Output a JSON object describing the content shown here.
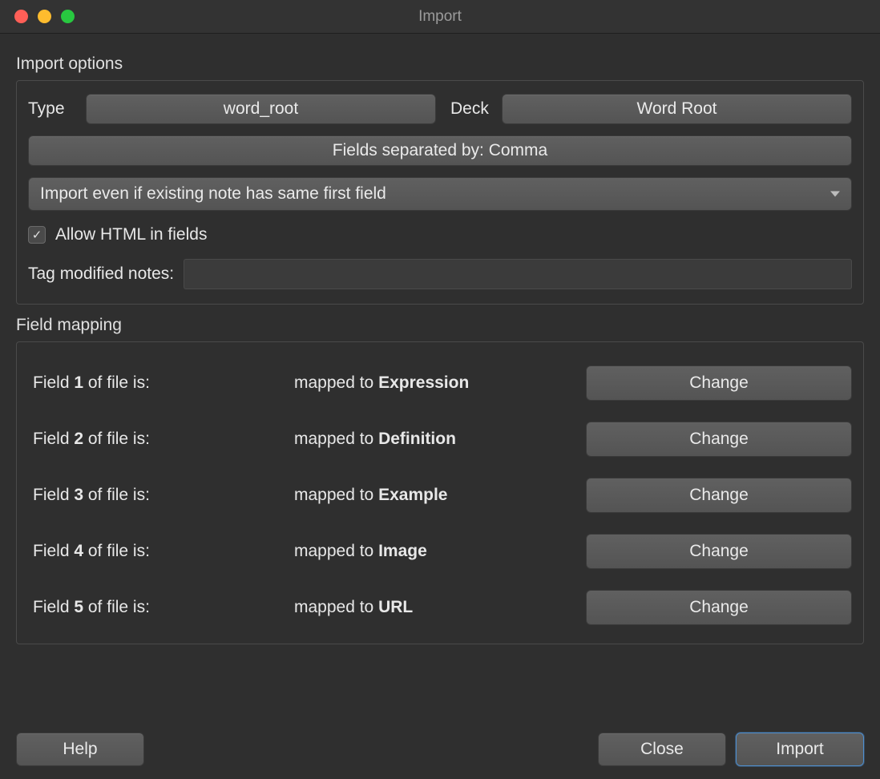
{
  "window": {
    "title": "Import"
  },
  "importOptions": {
    "section_label": "Import options",
    "type_label": "Type",
    "type_value": "word_root",
    "deck_label": "Deck",
    "deck_value": "Word Root",
    "separator_button": "Fields separated by: Comma",
    "update_mode": "Import even if existing note has same first field",
    "allow_html_label": "Allow HTML in fields",
    "allow_html_checked": true,
    "tag_modified_label": "Tag modified notes:",
    "tag_modified_value": ""
  },
  "fieldMapping": {
    "section_label": "Field mapping",
    "field_prefix": "Field ",
    "field_suffix": " of file is:",
    "mapped_prefix": "mapped to ",
    "change_label": "Change",
    "rows": [
      {
        "n": "1",
        "target": "Expression"
      },
      {
        "n": "2",
        "target": "Definition"
      },
      {
        "n": "3",
        "target": "Example"
      },
      {
        "n": "4",
        "target": "Image"
      },
      {
        "n": "5",
        "target": "URL"
      }
    ]
  },
  "footer": {
    "help": "Help",
    "close": "Close",
    "import": "Import"
  }
}
